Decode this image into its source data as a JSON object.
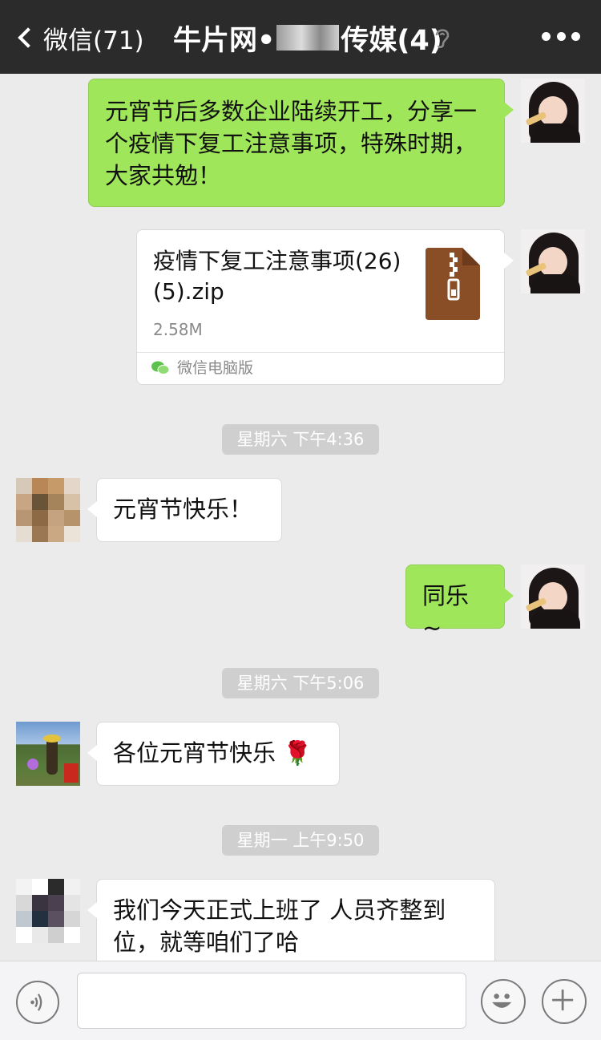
{
  "header": {
    "back_label": "微信(71)",
    "title_prefix": "牛片网•",
    "title_suffix": "传媒(4)",
    "back_icon": "chevron-left-icon",
    "mute_icon": "ear-icon",
    "more_icon": "more-dots-icon"
  },
  "messages": [
    {
      "side": "right",
      "text": "元宵节后多数企业陆续开工，分享一个疫情下复工注意事项，特殊时期，大家共勉！"
    },
    {
      "side": "right",
      "type": "file",
      "file_name": "疫情下复工注意事项(26)(5).zip",
      "file_size": "2.58M",
      "source": "微信电脑版"
    },
    {
      "type": "time",
      "text": "星期六 下午4:36"
    },
    {
      "side": "left",
      "text": "元宵节快乐！"
    },
    {
      "side": "right",
      "text": "同乐~"
    },
    {
      "type": "time",
      "text": "星期六 下午5:06"
    },
    {
      "side": "left",
      "text": "各位元宵节快乐",
      "emoji": "🌹"
    },
    {
      "type": "time",
      "text": "星期一 上午9:50"
    },
    {
      "side": "left",
      "text": "我们今天正式上班了 人员齐整到位，就等咱们了哈"
    }
  ],
  "input_bar": {
    "text_value": "",
    "voice_icon": "voice-icon",
    "emoji_icon": "emoji-icon",
    "plus_icon": "plus-icon"
  },
  "colors": {
    "header_bg": "#2b2b2b",
    "chat_bg": "#ebebeb",
    "bubble_self": "#9fe65a",
    "bubble_other": "#ffffff"
  }
}
